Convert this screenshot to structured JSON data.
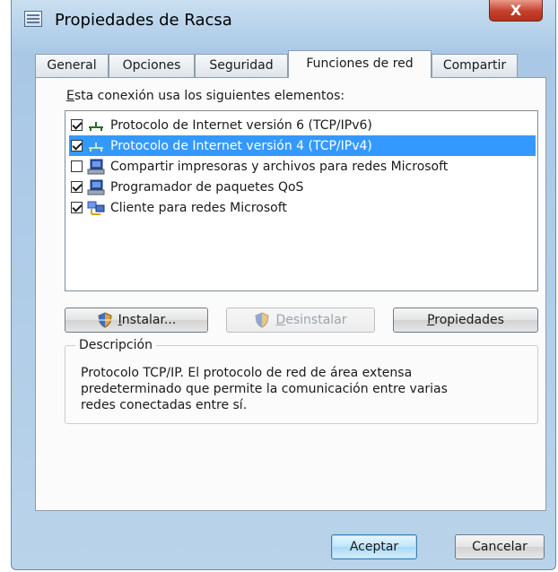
{
  "window": {
    "title": "Propiedades de Racsa",
    "close_label": "X"
  },
  "tabs": [
    {
      "label": "General",
      "active": false
    },
    {
      "label": "Opciones",
      "active": false
    },
    {
      "label": "Seguridad",
      "active": false
    },
    {
      "label": "Funciones de red",
      "active": true
    },
    {
      "label": "Compartir",
      "active": false
    }
  ],
  "network": {
    "uses_label_mnemonic": "E",
    "uses_label_rest": "sta conexión usa los siguientes elementos:",
    "items": [
      {
        "label": "Protocolo de Internet versión 6 (TCP/IPv6)",
        "checked": true,
        "selected": false,
        "icon": "protocol-icon"
      },
      {
        "label": "Protocolo de Internet versión 4 (TCP/IPv4)",
        "checked": true,
        "selected": true,
        "icon": "protocol-icon"
      },
      {
        "label": "Compartir impresoras y archivos para redes Microsoft",
        "checked": false,
        "selected": false,
        "icon": "service-icon"
      },
      {
        "label": "Programador de paquetes QoS",
        "checked": true,
        "selected": false,
        "icon": "service-icon"
      },
      {
        "label": "Cliente para redes Microsoft",
        "checked": true,
        "selected": false,
        "icon": "client-icon"
      }
    ]
  },
  "buttons": {
    "install_mnemonic": "I",
    "install_rest": "nstalar...",
    "uninstall_mnemonic": "D",
    "uninstall_rest": "esinstalar",
    "properties_mnemonic": "P",
    "properties_rest": "ropiedades",
    "ok": "Aceptar",
    "cancel": "Cancelar"
  },
  "description": {
    "legend": "Descripción",
    "line1": "Protocolo TCP/IP. El protocolo de red de área extensa",
    "line2": "predeterminado que permite la comunicación entre varias",
    "line3": "redes conectadas entre sí."
  },
  "colors": {
    "selection": "#3399ff",
    "titlebar": "#a9c8e6",
    "close_button": "#c4402c"
  }
}
